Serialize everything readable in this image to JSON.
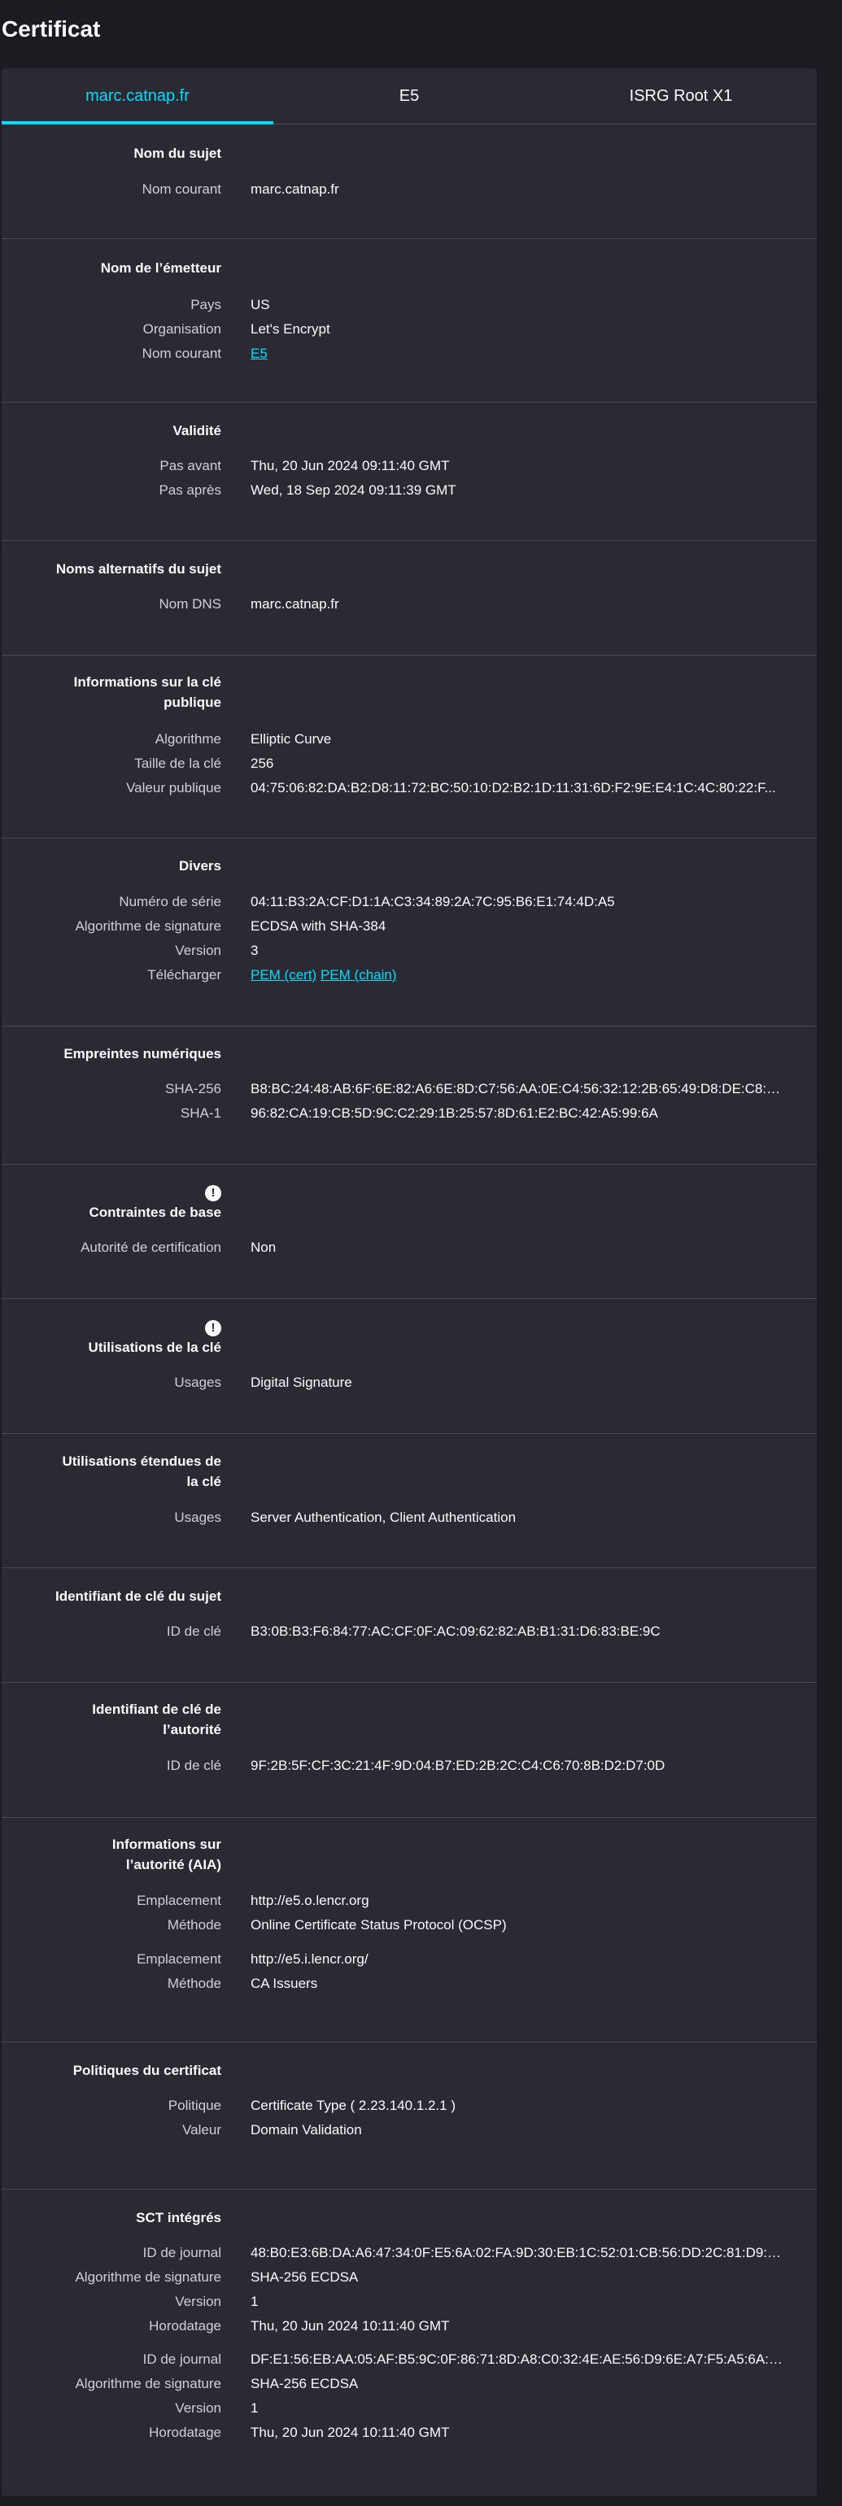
{
  "title": "Certificat",
  "tabs": [
    "marc.catnap.fr",
    "E5",
    "ISRG Root X1"
  ],
  "sections": {
    "subject": {
      "title": "Nom du sujet",
      "rows": [
        {
          "label": "Nom courant",
          "value": "marc.catnap.fr"
        }
      ]
    },
    "issuer": {
      "title": "Nom de l’émetteur",
      "rows": [
        {
          "label": "Pays",
          "value": "US"
        },
        {
          "label": "Organisation",
          "value": "Let's Encrypt"
        },
        {
          "label": "Nom courant",
          "value": "E5"
        }
      ]
    },
    "validity": {
      "title": "Validité",
      "rows": [
        {
          "label": "Pas avant",
          "value": "Thu, 20 Jun 2024 09:11:40 GMT"
        },
        {
          "label": "Pas après",
          "value": "Wed, 18 Sep 2024 09:11:39 GMT"
        }
      ]
    },
    "san": {
      "title": "Noms alternatifs du sujet",
      "rows": [
        {
          "label": "Nom DNS",
          "value": "marc.catnap.fr"
        }
      ]
    },
    "pubkey": {
      "title_line1": "Informations sur la clé",
      "title_line2": "publique",
      "rows": [
        {
          "label": "Algorithme",
          "value": "Elliptic Curve"
        },
        {
          "label": "Taille de la clé",
          "value": "256"
        },
        {
          "label": "Valeur publique",
          "value": "04:75:06:82:DA:B2:D8:11:72:BC:50:10:D2:B2:1D:11:31:6D:F2:9E:E4:1C:4C:80:22:F..."
        }
      ]
    },
    "misc": {
      "title": "Divers",
      "rows": [
        {
          "label": "Numéro de série",
          "value": "04:11:B3:2A:CF:D1:1A:C3:34:89:2A:7C:95:B6:E1:74:4D:A5"
        },
        {
          "label": "Algorithme de signature",
          "value": "ECDSA with SHA-384"
        },
        {
          "label": "Version",
          "value": "3"
        },
        {
          "label": "Télécharger",
          "link1": "PEM (cert)",
          "link2": "PEM (chain)"
        }
      ]
    },
    "fingerprints": {
      "title": "Empreintes numériques",
      "rows": [
        {
          "label": "SHA-256",
          "value": "B8:BC:24:48:AB:6F:6E:82:A6:6E:8D:C7:56:AA:0E:C4:56:32:12:2B:65:49:D8:DE:C8:D..."
        },
        {
          "label": "SHA-1",
          "value": "96:82:CA:19:CB:5D:9C:C2:29:1B:25:57:8D:61:E2:BC:42:A5:99:6A"
        }
      ]
    },
    "basic": {
      "title": "Contraintes de base",
      "rows": [
        {
          "label": "Autorité de certification",
          "value": "Non"
        }
      ]
    },
    "keyusage": {
      "title": "Utilisations de la clé",
      "rows": [
        {
          "label": "Usages",
          "value": "Digital Signature"
        }
      ]
    },
    "extkeyusage": {
      "title_line1": "Utilisations étendues de",
      "title_line2": "la clé",
      "rows": [
        {
          "label": "Usages",
          "value": "Server Authentication, Client Authentication"
        }
      ]
    },
    "ski": {
      "title": "Identifiant de clé du sujet",
      "rows": [
        {
          "label": "ID de clé",
          "value": "B3:0B:B3:F6:84:77:AC:CF:0F:AC:09:62:82:AB:B1:31:D6:83:BE:9C"
        }
      ]
    },
    "aki": {
      "title_line1": "Identifiant de clé de",
      "title_line2": "l’autorité",
      "rows": [
        {
          "label": "ID de clé",
          "value": "9F:2B:5F:CF:3C:21:4F:9D:04:B7:ED:2B:2C:C4:C6:70:8B:D2:D7:0D"
        }
      ]
    },
    "aia": {
      "title_line1": "Informations sur",
      "title_line2": "l’autorité (AIA)",
      "rows": [
        {
          "label": "Emplacement",
          "value": "http://e5.o.lencr.org"
        },
        {
          "label": "Méthode",
          "value": "Online Certificate Status Protocol (OCSP)"
        },
        {
          "label": "Emplacement",
          "value": "http://e5.i.lencr.org/"
        },
        {
          "label": "Méthode",
          "value": "CA Issuers"
        }
      ]
    },
    "policies": {
      "title": "Politiques du certificat",
      "rows": [
        {
          "label": "Politique",
          "value": "Certificate Type ( 2.23.140.1.2.1 )"
        },
        {
          "label": "Valeur",
          "value": "Domain Validation"
        }
      ]
    },
    "sct": {
      "title": "SCT intégrés",
      "rows": [
        {
          "label": "ID de journal",
          "value": "48:B0:E3:6B:DA:A6:47:34:0F:E5:6A:02:FA:9D:30:EB:1C:52:01:CB:56:DD:2C:81:D9:B..."
        },
        {
          "label": "Algorithme de signature",
          "value": "SHA-256 ECDSA"
        },
        {
          "label": "Version",
          "value": "1"
        },
        {
          "label": "Horodatage",
          "value": "Thu, 20 Jun 2024 10:11:40 GMT"
        },
        {
          "label": "ID de journal",
          "value": "DF:E1:56:EB:AA:05:AF:B5:9C:0F:86:71:8D:A8:C0:32:4E:AE:56:D9:6E:A7:F5:A5:6A:0..."
        },
        {
          "label": "Algorithme de signature",
          "value": "SHA-256 ECDSA"
        },
        {
          "label": "Version",
          "value": "1"
        },
        {
          "label": "Horodatage",
          "value": "Thu, 20 Jun 2024 10:11:40 GMT"
        }
      ]
    }
  }
}
